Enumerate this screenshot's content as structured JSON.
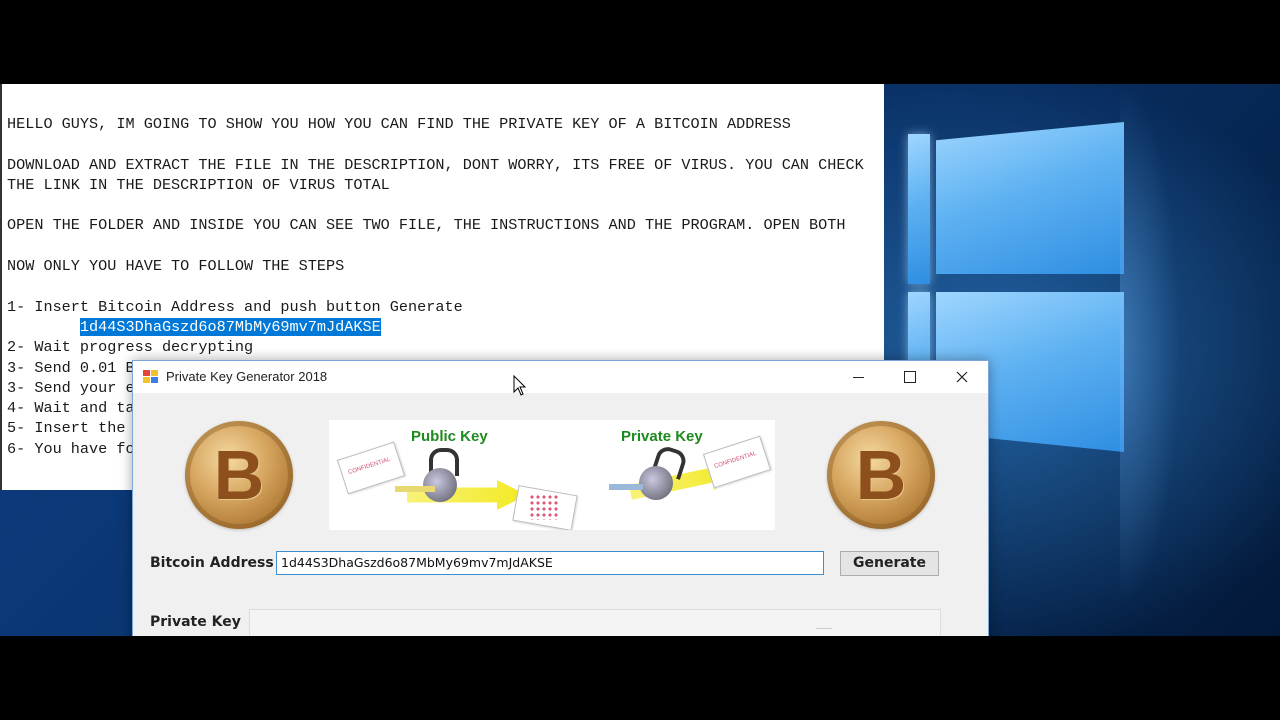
{
  "notepad": {
    "lines": [
      "HELLO GUYS, IM GOING TO SHOW YOU HOW YOU CAN FIND THE PRIVATE KEY OF A BITCOIN ADDRESS",
      "",
      "DOWNLOAD AND EXTRACT THE FILE IN THE DESCRIPTION, DONT WORRY, ITS FREE OF VIRUS. YOU CAN CHECK",
      "THE LINK IN THE DESCRIPTION OF VIRUS TOTAL",
      "",
      "OPEN THE FOLDER AND INSIDE YOU CAN SEE TWO FILE, THE INSTRUCTIONS AND THE PROGRAM. OPEN BOTH",
      "",
      "NOW ONLY YOU HAVE TO FOLLOW THE STEPS",
      "",
      "1- Insert Bitcoin Address and push button Generate"
    ],
    "selected_indent": "        ",
    "selected_text": "1d44S3DhaGszd6o87MbMy69mv7mJdAKSE",
    "steps_visible": [
      "2- Wait progress decrypting",
      "3- Send 0.01 B",
      "3- Send your e",
      "4- Wait and ta",
      "5- Insert the",
      "6- You have fo"
    ]
  },
  "dialog": {
    "title": "Private Key Generator 2018",
    "minimize_icon": "minimize-icon",
    "maximize_icon": "maximize-icon",
    "close_icon": "close-icon",
    "banner": {
      "public_key_label": "Public Key",
      "private_key_label": "Private Key",
      "paper_text": "CONFIDENTIAL"
    },
    "coin_symbol": "B",
    "bitcoin_address_label": "Bitcoin Address",
    "bitcoin_address_value": "1d44S3DhaGszd6o87MbMy69mv7mJdAKSE",
    "generate_label": "Generate",
    "private_key_label": "Private Key",
    "private_key_value": ""
  },
  "colors": {
    "selection": "#0078d7",
    "key_label_green": "#1f8a1f",
    "input_border": "#3d8fd1"
  }
}
